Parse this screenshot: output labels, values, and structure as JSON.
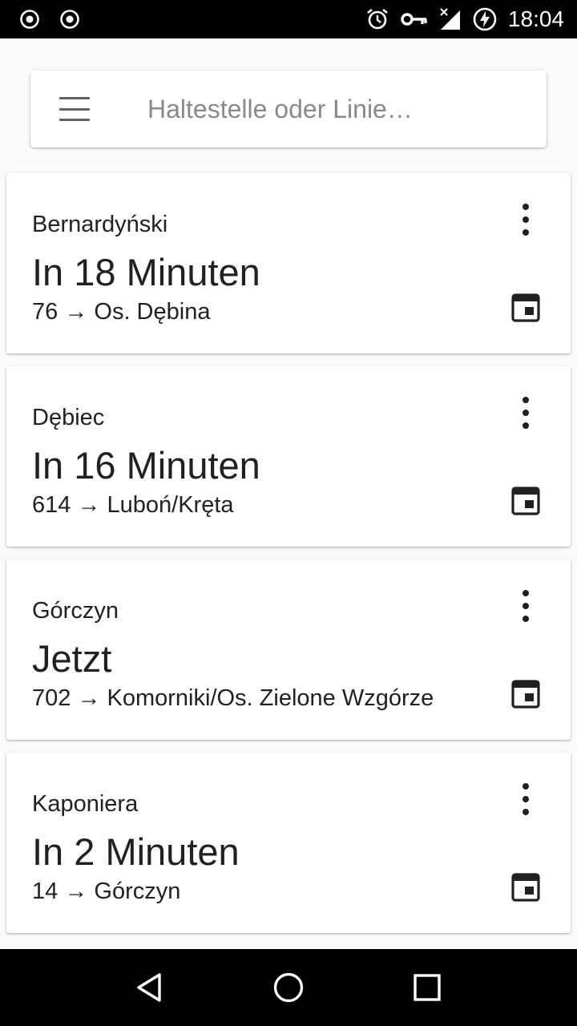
{
  "status_bar": {
    "time": "18:04",
    "left_icons": [
      "record-icon",
      "record-icon"
    ],
    "right_icons": [
      "alarm-icon",
      "vpn-key-icon",
      "signal-off-icon",
      "battery-charging-icon"
    ]
  },
  "search": {
    "placeholder": "Haltestelle oder Linie…",
    "value": ""
  },
  "departures": [
    {
      "stop": "Bernardyński",
      "time": "In 18 Minuten",
      "line": "76",
      "arrow": "→",
      "direction": "Os. Dębina"
    },
    {
      "stop": "Dębiec",
      "time": "In 16 Minuten",
      "line": "614",
      "arrow": "→",
      "direction": "Luboń/Kręta"
    },
    {
      "stop": "Górczyn",
      "time": "Jetzt",
      "line": "702",
      "arrow": "→",
      "direction": "Komorniki/Os. Zielone Wzgórze"
    },
    {
      "stop": "Kaponiera",
      "time": "In 2 Minuten",
      "line": "14",
      "arrow": "→",
      "direction": "Górczyn"
    }
  ],
  "navigation": [
    "back-icon",
    "home-icon",
    "recents-icon"
  ]
}
